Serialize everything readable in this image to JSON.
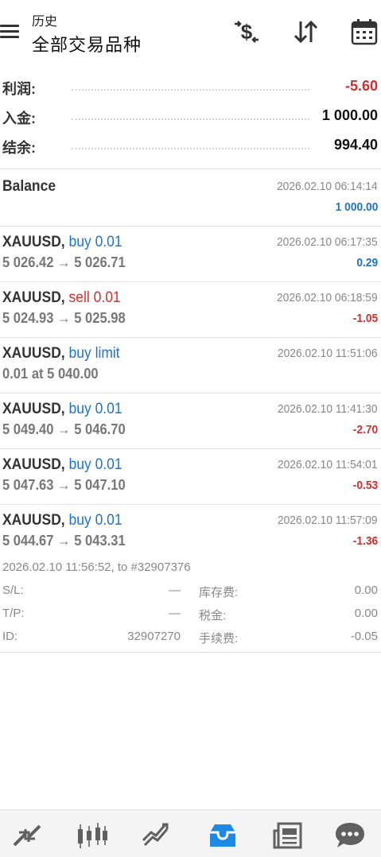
{
  "header": {
    "subtitle": "历史",
    "title": "全部交易品种"
  },
  "summary": [
    {
      "label": "利润:",
      "value": "-5.60",
      "negative": true
    },
    {
      "label": "入金:",
      "value": "1 000.00",
      "negative": false
    },
    {
      "label": "结余:",
      "value": "994.40",
      "negative": false
    }
  ],
  "balance": {
    "label": "Balance",
    "time": "2026.02.10 06:14:14",
    "amount": "1 000.00"
  },
  "trades": [
    {
      "symbol": "XAUUSD,",
      "action": "buy 0.01",
      "side": "buy",
      "prices": "5 026.42 → 5 026.71",
      "time": "2026.02.10 06:17:35",
      "profit": "0.29"
    },
    {
      "symbol": "XAUUSD,",
      "action": "sell 0.01",
      "side": "sell",
      "prices": "5 024.93 → 5 025.98",
      "time": "2026.02.10 06:18:59",
      "profit": "-1.05"
    },
    {
      "symbol": "XAUUSD,",
      "action": "buy limit",
      "side": "buy",
      "prices": "0.01 at 5 040.00",
      "time": "2026.02.10 11:51:06",
      "profit": ""
    },
    {
      "symbol": "XAUUSD,",
      "action": "buy 0.01",
      "side": "buy",
      "prices": "5 049.40 → 5 046.70",
      "time": "2026.02.10 11:41:30",
      "profit": "-2.70"
    },
    {
      "symbol": "XAUUSD,",
      "action": "buy 0.01",
      "side": "buy",
      "prices": "5 047.63 → 5 047.10",
      "time": "2026.02.10 11:54:01",
      "profit": "-0.53"
    },
    {
      "symbol": "XAUUSD,",
      "action": "buy 0.01",
      "side": "buy",
      "prices": "5 044.67 → 5 043.31",
      "time": "2026.02.10 11:57:09",
      "profit": "-1.36"
    }
  ],
  "expanded": {
    "close_info": "2026.02.10 11:56:52, to #32907376",
    "sl_label": "S/L:",
    "sl_value": "—",
    "swap_label": "库存费:",
    "swap_value": "0.00",
    "tp_label": "T/P:",
    "tp_value": "—",
    "tax_label": "税金:",
    "tax_value": "0.00",
    "id_label": "ID:",
    "id_value": "32907270",
    "fee_label": "手续费:",
    "fee_value": "-0.05"
  },
  "icons": {
    "menu": "menu-icon",
    "currency": "dollar-swap-icon",
    "sort": "sort-icon",
    "calendar": "calendar-icon",
    "nav": [
      "quotes-icon",
      "chart-icon",
      "trade-icon",
      "history-icon",
      "news-icon",
      "chat-icon"
    ]
  },
  "colors": {
    "buy": "#1e73c8",
    "sell": "#d32f2f",
    "active_nav": "#1e88e5",
    "inactive_nav": "#606060"
  }
}
